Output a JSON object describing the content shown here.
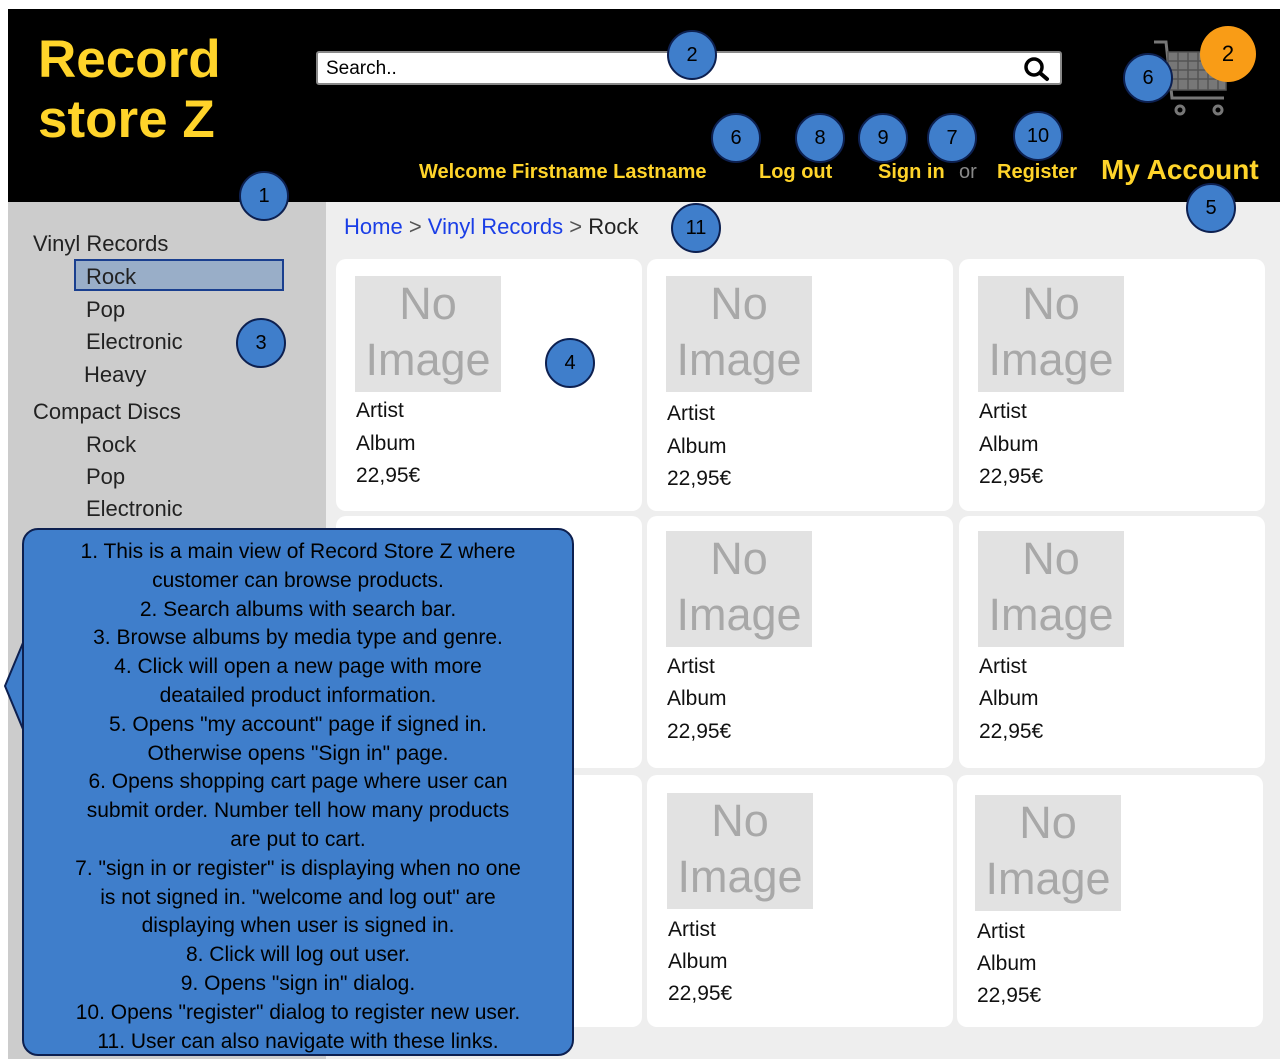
{
  "logo": {
    "line1": "Record",
    "line2": "store Z"
  },
  "search": {
    "placeholder": "Search.."
  },
  "cart": {
    "count": "2"
  },
  "user_bar": {
    "welcome": "Welcome Firstname Lastname",
    "logout": "Log out",
    "sign_in": "Sign in",
    "or": "or",
    "register": "Register",
    "my_account": "My Account"
  },
  "sidebar": {
    "categories": [
      {
        "title": "Vinyl Records",
        "items": [
          "Rock",
          "Pop",
          "Electronic",
          "Heavy"
        ],
        "selected": "Rock"
      },
      {
        "title": "Compact Discs",
        "items": [
          "Rock",
          "Pop",
          "Electronic"
        ]
      }
    ]
  },
  "breadcrumb": {
    "home": "Home",
    "sep": ">",
    "category": "Vinyl Records",
    "current": "Rock"
  },
  "products": [
    {
      "image_text_1": "No",
      "image_text_2": "Image",
      "artist": "Artist",
      "album": "Album",
      "price": "22,95€"
    },
    {
      "image_text_1": "No",
      "image_text_2": "Image",
      "artist": "Artist",
      "album": "Album",
      "price": "22,95€"
    },
    {
      "image_text_1": "No",
      "image_text_2": "Image",
      "artist": "Artist",
      "album": "Album",
      "price": "22,95€"
    },
    {
      "image_text_1": "No",
      "image_text_2": "Image",
      "artist": "Artist",
      "album": "Album",
      "price": "22,95€"
    },
    {
      "image_text_1": "No",
      "image_text_2": "Image",
      "artist": "Artist",
      "album": "Album",
      "price": "22,95€"
    },
    {
      "image_text_1": "No",
      "image_text_2": "Image",
      "artist": "Artist",
      "album": "Album",
      "price": "22,95€"
    },
    {
      "image_text_1": "No",
      "image_text_2": "Image",
      "artist": "Artist",
      "album": "Album",
      "price": "22,95€"
    }
  ],
  "annotations": {
    "badges": [
      "1",
      "2",
      "3",
      "4",
      "5",
      "6",
      "6",
      "7",
      "8",
      "9",
      "10",
      "11"
    ],
    "notes": [
      "1. This is a main view of Record Store Z where",
      "customer can browse products.",
      "2. Search albums with search bar.",
      "3. Browse albums by media type and genre.",
      "4. Click will open a new page with more",
      "deatailed product information.",
      "5. Opens \"my account\" page if signed in.",
      "Otherwise opens \"Sign in\" page.",
      "6. Opens shopping cart page where user can",
      "submit order. Number tell how many products",
      "are put to cart.",
      "7. \"sign in or register\" is displaying when no one",
      "is not signed in. \"welcome and log out\" are",
      "displaying when user is signed in.",
      "8. Click will log out user.",
      "9. Opens \"sign in\" dialog.",
      "10. Opens \"register\" dialog to register new user.",
      "11. User can also navigate with these links."
    ]
  },
  "colors": {
    "header_bg": "#000000",
    "accent_yellow": "#ffd42a",
    "cart_badge": "#f99c16",
    "annotation_blue": "#3f7ecb",
    "link_blue": "#1a3ee6",
    "sidebar_bg": "#cccccc",
    "selected_bg": "#99aec8"
  }
}
